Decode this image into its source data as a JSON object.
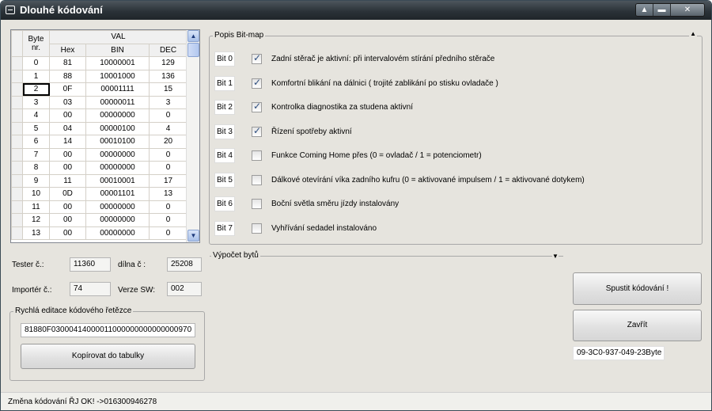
{
  "window": {
    "title": "Dlouhé kódování",
    "controls": [
      "▲",
      "▬",
      "✕"
    ]
  },
  "table": {
    "header_byte": "Byte nr.",
    "header_group": "VAL",
    "columns": [
      "Hex",
      "BIN",
      "DEC"
    ],
    "rows": [
      {
        "n": "0",
        "hex": "81",
        "bin": "10000001",
        "dec": "129"
      },
      {
        "n": "1",
        "hex": "88",
        "bin": "10001000",
        "dec": "136"
      },
      {
        "n": "2",
        "hex": "0F",
        "bin": "00001111",
        "dec": "15"
      },
      {
        "n": "3",
        "hex": "03",
        "bin": "00000011",
        "dec": "3"
      },
      {
        "n": "4",
        "hex": "00",
        "bin": "00000000",
        "dec": "0"
      },
      {
        "n": "5",
        "hex": "04",
        "bin": "00000100",
        "dec": "4"
      },
      {
        "n": "6",
        "hex": "14",
        "bin": "00010100",
        "dec": "20"
      },
      {
        "n": "7",
        "hex": "00",
        "bin": "00000000",
        "dec": "0"
      },
      {
        "n": "8",
        "hex": "00",
        "bin": "00000000",
        "dec": "0"
      },
      {
        "n": "9",
        "hex": "11",
        "bin": "00010001",
        "dec": "17"
      },
      {
        "n": "10",
        "hex": "0D",
        "bin": "00001101",
        "dec": "13"
      },
      {
        "n": "11",
        "hex": "00",
        "bin": "00000000",
        "dec": "0"
      },
      {
        "n": "12",
        "hex": "00",
        "bin": "00000000",
        "dec": "0"
      },
      {
        "n": "13",
        "hex": "00",
        "bin": "00000000",
        "dec": "0"
      }
    ],
    "selected_row": 2
  },
  "tester": {
    "label": "Tester č.:",
    "value": "11360"
  },
  "dilna": {
    "label": "dílna č :",
    "value": "25208"
  },
  "importer": {
    "label": "Importér č.:",
    "value": "74"
  },
  "verze": {
    "label": "Verze SW:",
    "value": "002"
  },
  "quick_edit": {
    "title": "Rychlá editace kódového řetězce",
    "value": "81880F03000414000011000000000000000970",
    "copy_button": "Kopírovat do tabulky"
  },
  "bitmap": {
    "title": "Popis Bit-map",
    "bits": [
      {
        "label": "Bit 0",
        "checked": true,
        "text": "Zadní stěrač je aktivní: při intervalovém stírání předního stěrače"
      },
      {
        "label": "Bit 1",
        "checked": true,
        "text": "Komfortní blikání na dálnici ( trojité zablikání po stisku ovladače )"
      },
      {
        "label": "Bit 2",
        "checked": true,
        "text": "Kontrolka  diagnostika za studena aktivní"
      },
      {
        "label": "Bit 3",
        "checked": true,
        "text": "Řízení spotřeby aktivní"
      },
      {
        "label": "Bit 4",
        "checked": false,
        "text": "Funkce Coming Home přes (0 = ovladač / 1 = potenciometr)"
      },
      {
        "label": "Bit 5",
        "checked": false,
        "text": "Dálkové otevírání víka zadního kufru (0 = aktivované impulsem / 1 = aktivované dotykem)"
      },
      {
        "label": "Bit 6",
        "checked": false,
        "text": "Boční světla směru jízdy instalovány"
      },
      {
        "label": "Bit 7",
        "checked": false,
        "text": "Vyhřívání sedadel instalováno"
      }
    ]
  },
  "vypocet": {
    "title": "Výpočet bytů"
  },
  "actions": {
    "start_button": "Spustit kódování !",
    "close_button": "Zavřít",
    "part_number": "09-3C0-937-049-23Byte"
  },
  "status": {
    "text": "Změna kódování ŘJ OK! ->016300946278"
  }
}
